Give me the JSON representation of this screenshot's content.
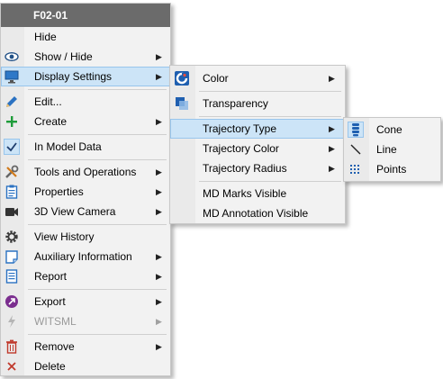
{
  "main_menu": {
    "title": "F02-01",
    "items": [
      {
        "label": "Hide",
        "icon": "none"
      },
      {
        "label": "Show / Hide",
        "icon": "eye-icon"
      },
      {
        "label": "Display Settings",
        "icon": "monitor-icon"
      },
      {
        "label": "Edit...",
        "icon": "pencil-icon"
      },
      {
        "label": "Create",
        "icon": "plus-icon"
      },
      {
        "label": "In Model Data",
        "icon": "checkmark-icon"
      },
      {
        "label": "Tools and Operations",
        "icon": "tools-icon"
      },
      {
        "label": "Properties",
        "icon": "clipboard-icon"
      },
      {
        "label": "3D View Camera",
        "icon": "camera-icon"
      },
      {
        "label": "View History",
        "icon": "gear-icon"
      },
      {
        "label": "Auxiliary Information",
        "icon": "note-icon"
      },
      {
        "label": "Report",
        "icon": "report-icon"
      },
      {
        "label": "Export",
        "icon": "export-icon"
      },
      {
        "label": "WITSML",
        "icon": "lightning-icon"
      },
      {
        "label": "Remove",
        "icon": "trash-icon"
      },
      {
        "label": "Delete",
        "icon": "x-icon"
      }
    ]
  },
  "display_settings_menu": {
    "items": [
      {
        "label": "Color",
        "icon": "color-palette-icon"
      },
      {
        "label": "Transparency",
        "icon": "transparency-icon"
      },
      {
        "label": "Trajectory Type"
      },
      {
        "label": "Trajectory Color"
      },
      {
        "label": "Trajectory Radius"
      },
      {
        "label": "MD Marks Visible"
      },
      {
        "label": "MD Annotation Visible"
      }
    ]
  },
  "trajectory_type_menu": {
    "items": [
      {
        "label": "Cone",
        "icon": "cone-icon"
      },
      {
        "label": "Line",
        "icon": "line-icon"
      },
      {
        "label": "Points",
        "icon": "points-icon"
      }
    ]
  },
  "colors": {
    "title_bar": "#6b6b6b",
    "highlight": "#cce4f7",
    "highlight_border": "#98c5ec",
    "menu_bg": "#f2f2f2",
    "disabled_text": "#9a9a9a"
  }
}
